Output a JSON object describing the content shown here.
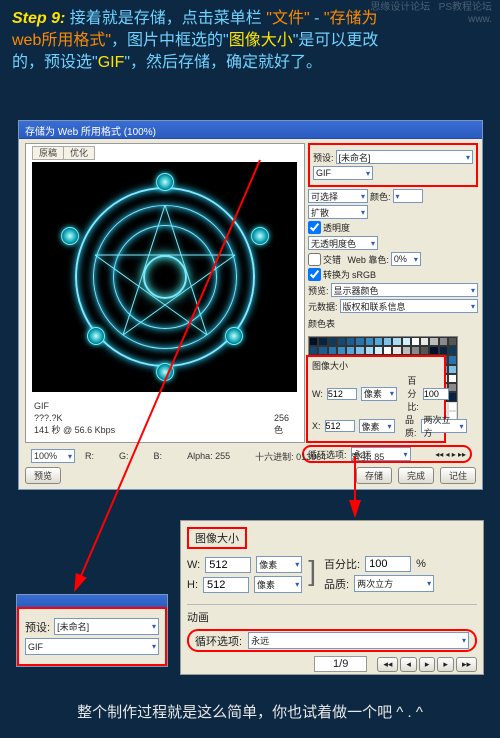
{
  "watermark": {
    "l1": "思缘设计论坛",
    "l2": "PS教程论坛",
    "l3": "www."
  },
  "step_label": "Step 9:",
  "instr": {
    "p1a": "接着就是存储，点击菜单栏",
    "file": "\"文件\"",
    "dash": " - ",
    "saveas": "\"存储为",
    "p2a": "web所用格式\"",
    "p2b": "，图片中框选的\"",
    "imgsize": "图像大小",
    "p2c": "\"是可以更改",
    "p3a": "的，预设选\"",
    "gif": "GIF",
    "p3b": "\"，然后存储，确定就好了。"
  },
  "dialog": {
    "title": "存储为 Web 所用格式 (100%)",
    "tabs": {
      "a": "原稿",
      "b": "优化"
    },
    "info": {
      "fmt": "GIF",
      "size": "???.?K",
      "speed": "141 秒 @ 56.6 Kbps",
      "colors": "256 色"
    },
    "zoom": "100%",
    "r_row": "R:",
    "g_row": "G:",
    "b_row": "B:",
    "alpha": "Alpha: 255",
    "hex": "十六进制: 013964",
    "idx": "索引: 85",
    "buttons": {
      "preview": "预览",
      "save": "存储",
      "done": "完成",
      "cancel": "记住"
    }
  },
  "rp": {
    "preset_label": "预设:",
    "preset_val": "[未命名]",
    "fmt": "GIF",
    "dither_label": "可选择",
    "dither_val": "颜色:",
    "diff": "扩散",
    "transparency": "透明度",
    "matte": "无透明度色",
    "interlaced": "交错",
    "web": "Web 靠色:",
    "web_val": "0%",
    "convert": "转换为",
    "convert_val": "sRGB",
    "preview2": "显示器颜色",
    "metadata": "版权和联系信息",
    "palette": "颜色表",
    "imgsize": "图像大小",
    "w": "W:",
    "wv": "512",
    "wu": "像素",
    "h": "X:",
    "hv": "512",
    "hu": "像素",
    "percent": "百分比:",
    "pv": "100",
    "quality": "品质:",
    "qv": "两次立方",
    "loop": "循环选项:",
    "loopv": "永远"
  },
  "zoom1": {
    "preset_label": "预设:",
    "preset_val": "[未命名]",
    "fmt": "GIF"
  },
  "zoom2": {
    "title": "图像大小",
    "w": "W:",
    "wv": "512",
    "wu": "像素",
    "h": "H:",
    "hv": "512",
    "hu": "像素",
    "percent": "百分比:",
    "pv": "100",
    "pu": "%",
    "quality": "品质:",
    "qv": "两次立方",
    "anim": "动画",
    "loop": "循环选项:",
    "loopv": "永远",
    "frame": "1/9"
  },
  "footer": "整个制作过程就是这么简单，你也试着做一个吧 ^ . ^"
}
